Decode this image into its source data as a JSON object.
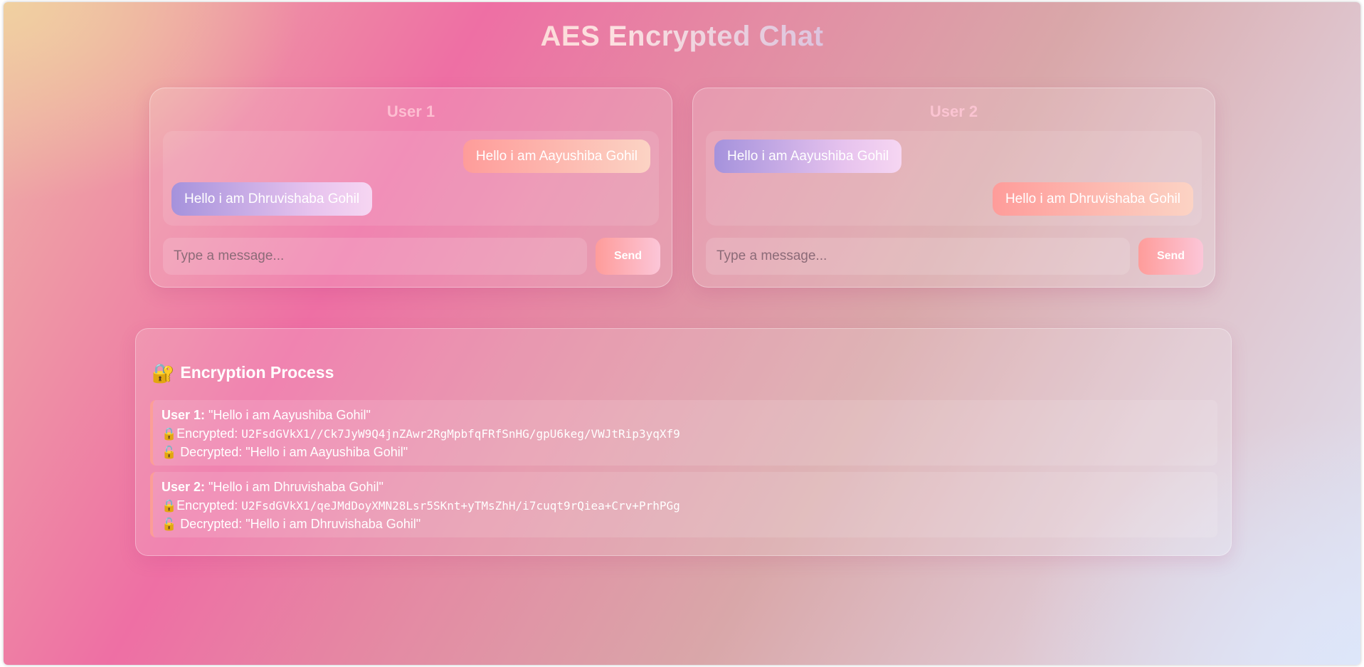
{
  "header": {
    "title": "AES Encrypted Chat"
  },
  "panels": [
    {
      "title": "User 1",
      "messages": [
        {
          "text": "Hello i am Aayushiba Gohil",
          "direction": "sent"
        },
        {
          "text": "Hello i am Dhruvishaba Gohil",
          "direction": "received"
        }
      ],
      "input_placeholder": "Type a message...",
      "send_label": "Send"
    },
    {
      "title": "User 2",
      "messages": [
        {
          "text": "Hello i am Aayushiba Gohil",
          "direction": "received"
        },
        {
          "text": "Hello i am Dhruvishaba Gohil",
          "direction": "sent"
        }
      ],
      "input_placeholder": "Type a message...",
      "send_label": "Send"
    }
  ],
  "process": {
    "title": "Encryption Process",
    "title_icon": "🔐",
    "entries": [
      {
        "user_label": "User 1:",
        "message": "\"Hello i am Aayushiba Gohil\"",
        "encrypted_icon": "🔒",
        "encrypted_label": "Encrypted:",
        "encrypted_value": "U2FsdGVkX1//Ck7JyW9Q4jnZAwr2RgMpbfqFRfSnHG/gpU6keg/VWJtRip3yqXf9",
        "decrypted_icon": "🔓",
        "decrypted_label": "Decrypted:",
        "decrypted_value": "\"Hello i am Aayushiba Gohil\""
      },
      {
        "user_label": "User 2:",
        "message": "\"Hello i am Dhruvishaba Gohil\"",
        "encrypted_icon": "🔒",
        "encrypted_label": "Encrypted:",
        "encrypted_value": "U2FsdGVkX1/qeJMdDoyXMN28Lsr5SKnt+yTMsZhH/i7cuqt9rQiea+Crv+PrhPGg",
        "decrypted_icon": "🔓",
        "decrypted_label": "Decrypted:",
        "decrypted_value": "\"Hello i am Dhruvishaba Gohil\""
      }
    ]
  },
  "colors": {
    "sent_bubble": "#fe9c9a",
    "received_bubble": "#a592dc",
    "send_button": "#fe9c9a"
  }
}
